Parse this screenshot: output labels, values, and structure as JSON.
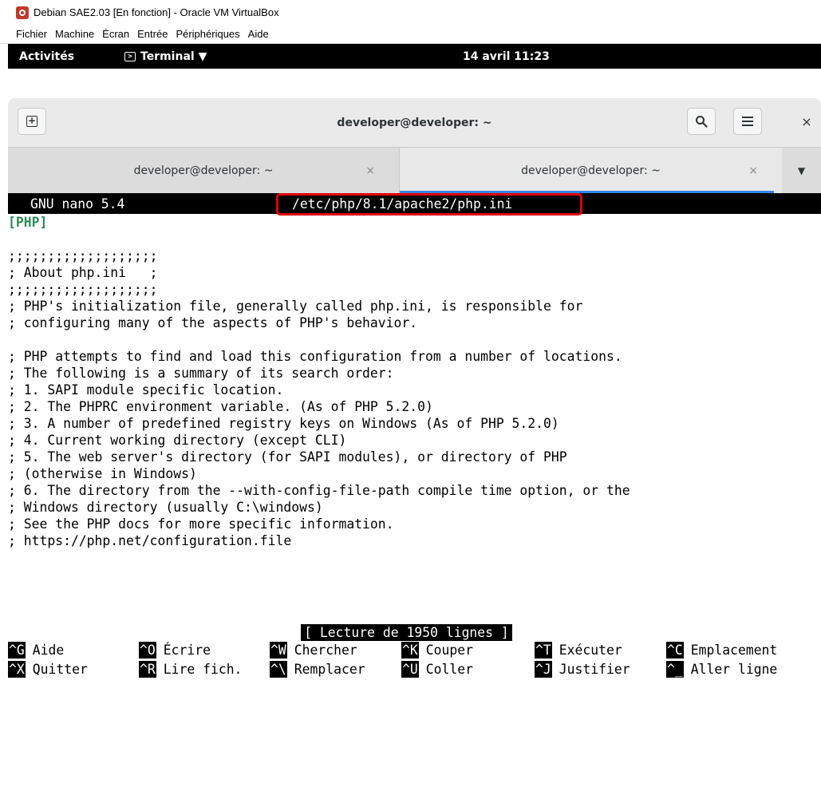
{
  "vbox": {
    "title": "Debian SAE2.03 [En fonction] - Oracle VM VirtualBox",
    "menu": [
      "Fichier",
      "Machine",
      "Écran",
      "Entrée",
      "Périphériques",
      "Aide"
    ]
  },
  "gnome": {
    "activities": "Activités",
    "app": "Terminal ▼",
    "clock": "14 avril 11:23"
  },
  "terminal": {
    "title": "developer@developer: ~",
    "tabs": [
      {
        "label": "developer@developer: ~",
        "active": false
      },
      {
        "label": "developer@developer: ~",
        "active": true
      }
    ],
    "tab_close": "×",
    "close": "×",
    "dropdown": "▼"
  },
  "nano": {
    "name": "GNU nano 5.4",
    "file": "/etc/php/8.1/apache2/php.ini",
    "lines": [
      "[PHP]",
      "",
      ";;;;;;;;;;;;;;;;;;;",
      "; About php.ini   ;",
      ";;;;;;;;;;;;;;;;;;;",
      "; PHP's initialization file, generally called php.ini, is responsible for",
      "; configuring many of the aspects of PHP's behavior.",
      "",
      "; PHP attempts to find and load this configuration from a number of locations.",
      "; The following is a summary of its search order:",
      "; 1. SAPI module specific location.",
      "; 2. The PHPRC environment variable. (As of PHP 5.2.0)",
      "; 3. A number of predefined registry keys on Windows (As of PHP 5.2.0)",
      "; 4. Current working directory (except CLI)",
      "; 5. The web server's directory (for SAPI modules), or directory of PHP",
      "; (otherwise in Windows)",
      "; 6. The directory from the --with-config-file-path compile time option, or the",
      "; Windows directory (usually C:\\windows)",
      "; See the PHP docs for more specific information.",
      "; https://php.net/configuration.file"
    ],
    "status": "[ Lecture de 1950 lignes ]",
    "shortcuts": [
      [
        {
          "key": "^G",
          "label": "Aide"
        },
        {
          "key": "^O",
          "label": "Écrire"
        },
        {
          "key": "^W",
          "label": "Chercher"
        },
        {
          "key": "^K",
          "label": "Couper"
        },
        {
          "key": "^T",
          "label": "Exécuter"
        },
        {
          "key": "^C",
          "label": "Emplacement"
        }
      ],
      [
        {
          "key": "^X",
          "label": "Quitter"
        },
        {
          "key": "^R",
          "label": "Lire fich."
        },
        {
          "key": "^\\",
          "label": "Remplacer"
        },
        {
          "key": "^U",
          "label": "Coller"
        },
        {
          "key": "^J",
          "label": "Justifier"
        },
        {
          "key": "^_",
          "label": "Aller ligne"
        }
      ]
    ]
  }
}
